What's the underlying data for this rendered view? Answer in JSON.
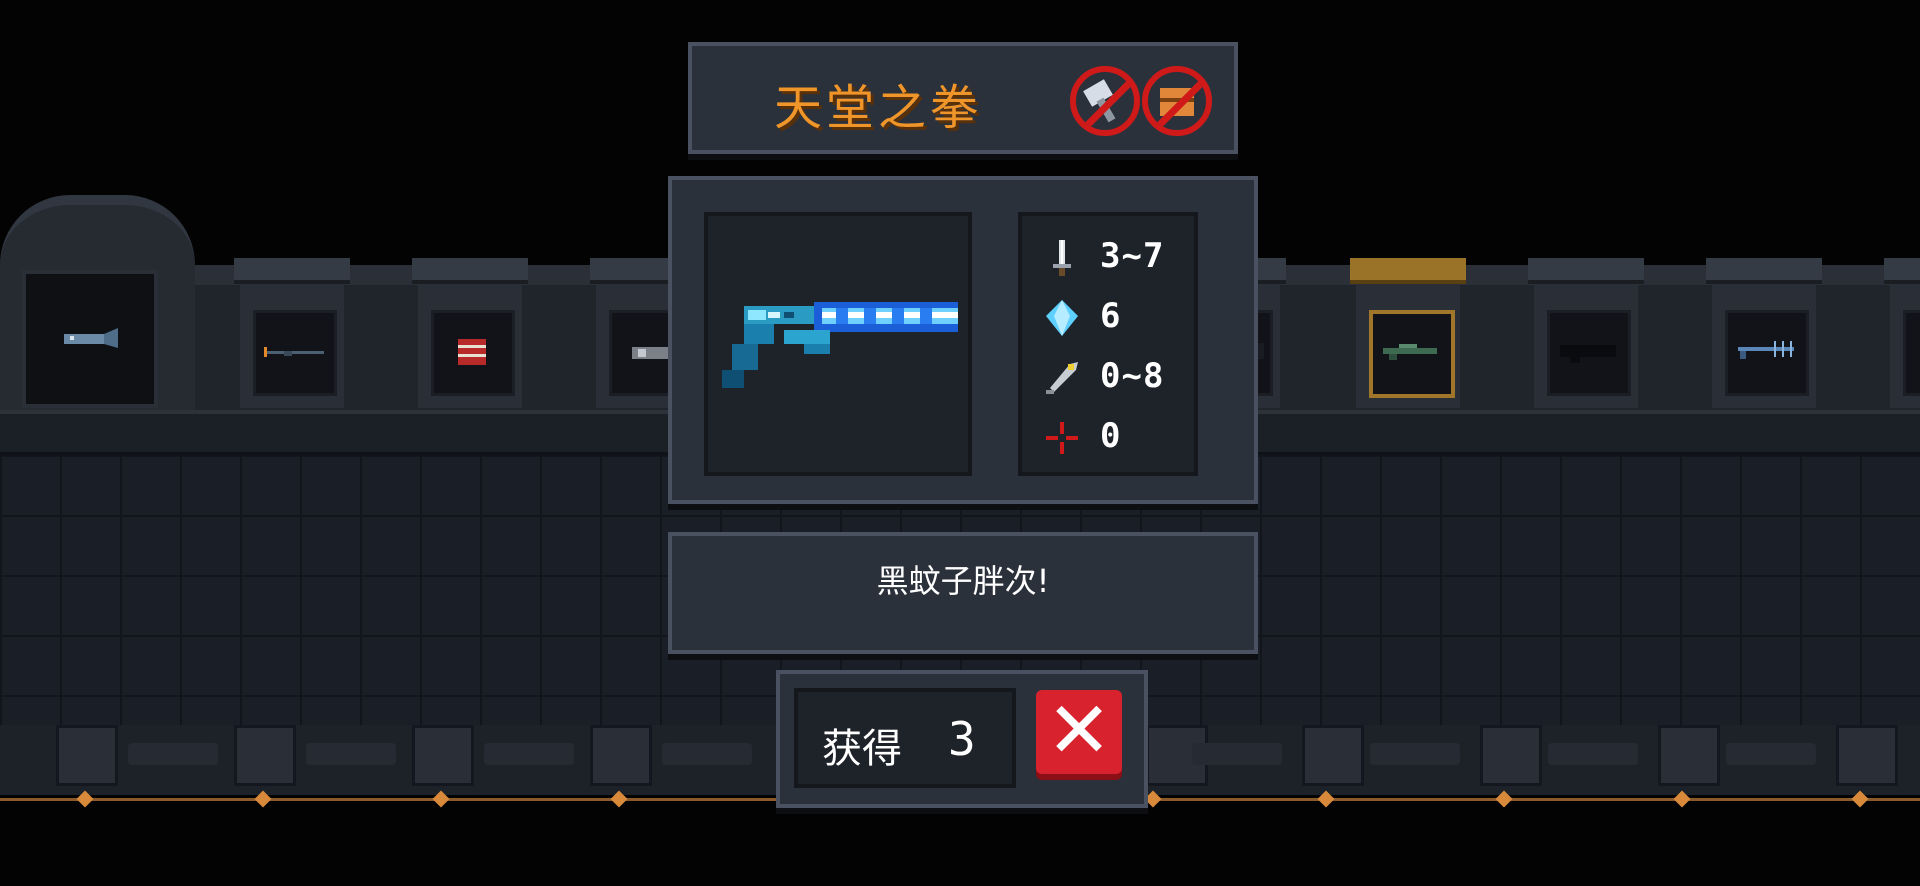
{
  "title": {
    "text": "天堂之拳",
    "color": "#f0952a",
    "badges": [
      {
        "icon": "no-hammer-icon"
      },
      {
        "icon": "no-chest-icon"
      }
    ]
  },
  "weapon": {
    "icon": "blue-laser-gun-icon",
    "stats": [
      {
        "icon": "damage-sword-icon",
        "value": "3~7"
      },
      {
        "icon": "energy-crystal-icon",
        "value": "6"
      },
      {
        "icon": "critical-feather-icon",
        "value": "0~8"
      },
      {
        "icon": "accuracy-crosshair-icon",
        "value": "0"
      }
    ]
  },
  "description": "黑蚊子胖次!",
  "obtain": {
    "label": "获得",
    "count": "3",
    "close_icon": "close-x-icon",
    "close_color": "#d8222e"
  },
  "background": {
    "weapon_slots": [
      {
        "icon": "fish-weapon-icon"
      },
      {
        "icon": "rod-weapon-icon"
      },
      {
        "icon": "dynamite-weapon-icon"
      },
      {
        "icon": "gray-gun-icon"
      },
      {
        "icon": "hidden-weapon-icon"
      },
      {
        "icon": "green-rifle-icon"
      },
      {
        "icon": "dark-cannon-icon"
      },
      {
        "icon": "trident-gun-icon"
      }
    ]
  }
}
